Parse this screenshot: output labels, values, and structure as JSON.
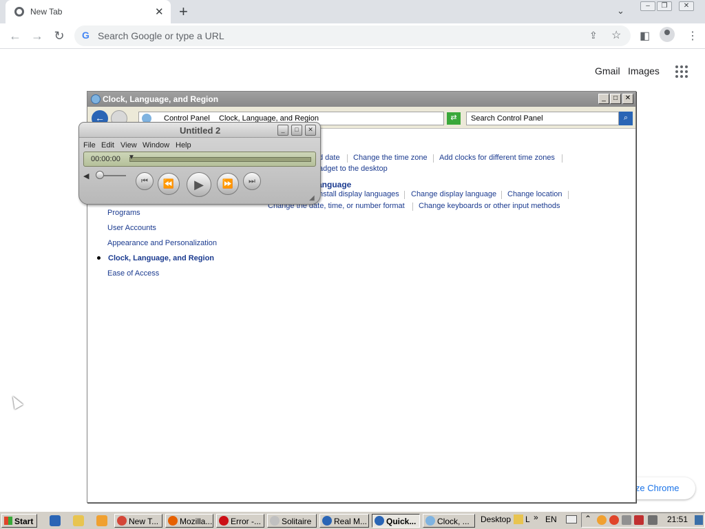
{
  "browser": {
    "tab": {
      "title": "New Tab"
    },
    "omnibox": {
      "placeholder": "Search Google or type a URL"
    },
    "ntp": {
      "gmail_label": "Gmail",
      "images_label": "Images",
      "customize_label": "ize Chrome"
    }
  },
  "control_panel": {
    "title": "Clock, Language, and Region",
    "breadcrumb": [
      "Control Panel",
      "Clock, Language, and Region"
    ],
    "search_placeholder": "Search Control Panel",
    "sections": [
      {
        "heading": "e",
        "links": [
          "d date",
          "Change the time zone",
          "Add clocks for different time zones",
          "adget to the desktop"
        ]
      },
      {
        "heading": "anguage",
        "links": [
          "nstall display languages",
          "Change display language",
          "Change location",
          "Change the date, time, or number format",
          "Change keyboards or other input methods"
        ]
      }
    ],
    "nav": {
      "items": [
        "Programs",
        "User Accounts",
        "Appearance and Personalization"
      ],
      "active": "Clock, Language, and Region",
      "last": "Ease of Access"
    }
  },
  "player": {
    "title": "Untitled 2",
    "menu": [
      "File",
      "Edit",
      "View",
      "Window",
      "Help"
    ],
    "time": "00:00:00",
    "controls": [
      "previous",
      "rewind",
      "play",
      "fast-forward",
      "next"
    ]
  },
  "taskbar": {
    "start_label": "Start",
    "tasks": [
      {
        "label": "New T...",
        "icon_color": "#d44638",
        "active": false
      },
      {
        "label": "Mozilla...",
        "icon_color": "#e66000",
        "active": false
      },
      {
        "label": "Error -...",
        "icon_color": "#cc0f16",
        "active": false
      },
      {
        "label": "Solitaire",
        "icon_color": "#c0c0c0",
        "active": false
      },
      {
        "label": "Real M...",
        "icon_color": "#2a65b5",
        "active": false
      },
      {
        "label": "Quick...",
        "icon_color": "#2a65b5",
        "active": true
      },
      {
        "label": "Clock, ...",
        "icon_color": "#7fb3e0",
        "active": false
      }
    ],
    "desktop_label": "Desktop",
    "toolbar_letter": "L",
    "language": "EN",
    "clock": "21:51"
  }
}
